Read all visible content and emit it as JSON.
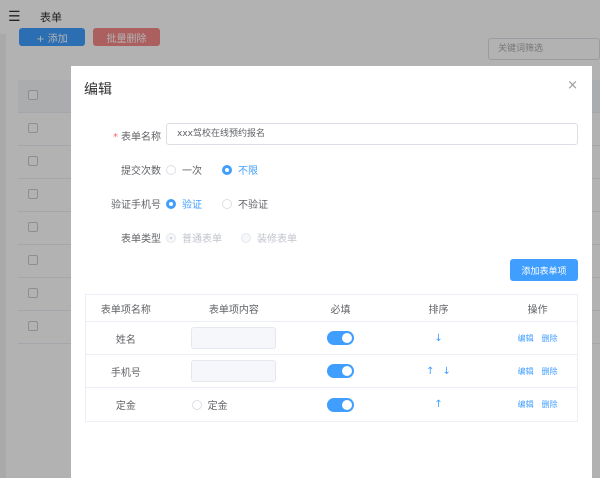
{
  "header": {
    "menu_icon": "hamburger-icon",
    "title": "表单"
  },
  "toolbar": {
    "add": "+ 添加",
    "batch_delete": "批量删除",
    "search_placeholder": "关键词筛选"
  },
  "modal": {
    "title": "编辑",
    "close": "×",
    "form": {
      "name_label": "表单名称",
      "name_value": "xxx驾校在线预约报名",
      "submit_label": "提交次数",
      "submit_options": [
        "一次",
        "不限"
      ],
      "submit_selected": "不限",
      "verify_label": "验证手机号",
      "verify_options": [
        "验证",
        "不验证"
      ],
      "verify_selected": "验证",
      "type_label": "表单类型",
      "type_options": [
        "普通表单",
        "装修表单"
      ],
      "type_selected": "普通表单"
    },
    "add_item_button": "添加表单项",
    "table": {
      "headers": [
        "表单项名称",
        "表单项内容",
        "必填",
        "排序",
        "操作"
      ],
      "rows": [
        {
          "name": "姓名",
          "required": true,
          "sort": [
            "↓"
          ]
        },
        {
          "name": "手机号",
          "required": true,
          "sort": [
            "↑",
            "↓"
          ]
        },
        {
          "name": "定金",
          "content_radio": "定金",
          "required": true,
          "sort": [
            "↑"
          ]
        }
      ],
      "edit": "编辑",
      "delete": "删除"
    }
  },
  "colors": {
    "primary": "#409eff",
    "danger": "#f56c6c"
  }
}
